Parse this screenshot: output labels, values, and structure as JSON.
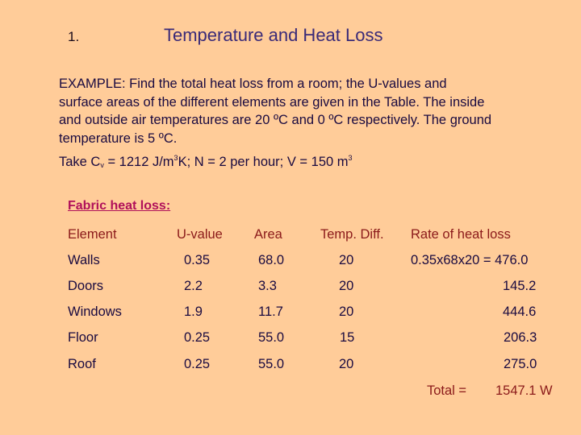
{
  "slide": {
    "number": "1.",
    "title": "Temperature and Heat Loss"
  },
  "problem": {
    "lines": [
      "EXAMPLE: Find the total heat loss from a room; the U-values and",
      "surface areas of the different elements are given in the Table. The inside",
      "and outside air temperatures are 20 ºC and 0 ºC respectively. The ground",
      "temperature is 5 ºC."
    ],
    "given": {
      "prefix": "Take C",
      "cv_sub": "v",
      "cv_value": " = 1212 J/m",
      "cv_sup": "3",
      "cv_unit": "K;  N = 2 per hour;  V = 150 m",
      "v_sup": "3"
    }
  },
  "section_heading": "Fabric heat loss:",
  "table": {
    "headers": [
      "Element",
      "U-value",
      "Area",
      "Temp. Diff.",
      "Rate of heat loss"
    ],
    "rows": [
      {
        "element": "Walls",
        "u_value": "0.35",
        "area": "68.0",
        "temp_diff": "20",
        "rate": "0.35x68x20 = 476.0"
      },
      {
        "element": "Doors",
        "u_value": "2.2",
        "area": "3.3",
        "temp_diff": "20",
        "rate": "145.2"
      },
      {
        "element": "Windows",
        "u_value": "1.9",
        "area": "11.7",
        "temp_diff": "20",
        "rate": "444.6"
      },
      {
        "element": "Floor",
        "u_value": "0.25",
        "area": "55.0",
        "temp_diff": "15",
        "rate": "206.3"
      },
      {
        "element": "Roof",
        "u_value": "0.25",
        "area": "55.0",
        "temp_diff": "20",
        "rate": "275.0"
      }
    ],
    "total_label": "Total =",
    "total_value": "1547.1 W"
  },
  "colors": {
    "background": "#ffcc99",
    "title": "#3a2a78",
    "body_text": "#1a0a40",
    "header_text": "#8b1a1a",
    "section_heading": "#b0105a"
  }
}
